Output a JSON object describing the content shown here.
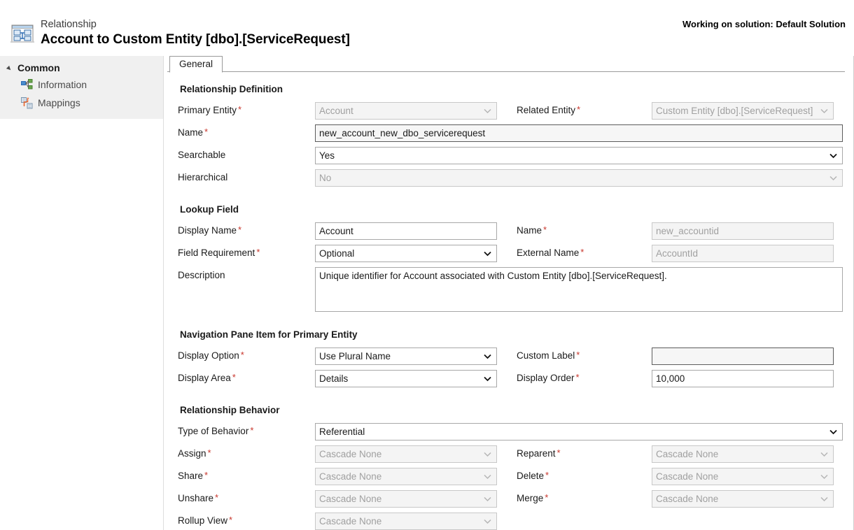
{
  "header": {
    "eyebrow": "Relationship",
    "title": "Account to Custom Entity [dbo].[ServiceRequest]",
    "solution_note": "Working on solution: Default Solution",
    "icon": "relationship-entity-icon"
  },
  "sidebar": {
    "group_label": "Common",
    "items": [
      {
        "label": "Information",
        "icon": "information-relationship-icon"
      },
      {
        "label": "Mappings",
        "icon": "mappings-icon"
      }
    ]
  },
  "tabs": [
    {
      "label": "General",
      "selected": true
    }
  ],
  "sections": {
    "relationship_definition": {
      "title": "Relationship Definition",
      "primary_entity": {
        "label": "Primary Entity",
        "required": true,
        "value": "Account",
        "disabled": true
      },
      "related_entity": {
        "label": "Related Entity",
        "required": true,
        "value": "Custom Entity [dbo].[ServiceRequest]",
        "disabled": true
      },
      "name": {
        "label": "Name",
        "required": true,
        "value": "new_account_new_dbo_servicerequest",
        "readonly": true
      },
      "searchable": {
        "label": "Searchable",
        "required": false,
        "value": "Yes",
        "disabled": false
      },
      "hierarchical": {
        "label": "Hierarchical",
        "required": false,
        "value": "No",
        "disabled": true
      }
    },
    "lookup_field": {
      "title": "Lookup Field",
      "display_name": {
        "label": "Display Name",
        "required": true,
        "value": "Account"
      },
      "name": {
        "label": "Name",
        "required": true,
        "value": "new_accountid",
        "disabled": true
      },
      "field_requirement": {
        "label": "Field Requirement",
        "required": true,
        "value": "Optional"
      },
      "external_name": {
        "label": "External Name",
        "required": true,
        "value": "AccountId",
        "disabled": true
      },
      "description": {
        "label": "Description",
        "required": false,
        "value": "Unique identifier for Account associated with Custom Entity [dbo].[ServiceRequest]."
      }
    },
    "navigation_pane": {
      "title": "Navigation Pane Item for Primary Entity",
      "display_option": {
        "label": "Display Option",
        "required": true,
        "value": "Use Plural Name"
      },
      "custom_label": {
        "label": "Custom Label",
        "required": true,
        "value": "",
        "readonly": true
      },
      "display_area": {
        "label": "Display Area",
        "required": true,
        "value": "Details"
      },
      "display_order": {
        "label": "Display Order",
        "required": true,
        "value": "10,000"
      }
    },
    "relationship_behavior": {
      "title": "Relationship Behavior",
      "type_of_behavior": {
        "label": "Type of Behavior",
        "required": true,
        "value": "Referential"
      },
      "assign": {
        "label": "Assign",
        "required": true,
        "value": "Cascade None",
        "disabled": true
      },
      "reparent": {
        "label": "Reparent",
        "required": true,
        "value": "Cascade None",
        "disabled": true
      },
      "share": {
        "label": "Share",
        "required": true,
        "value": "Cascade None",
        "disabled": true
      },
      "delete": {
        "label": "Delete",
        "required": true,
        "value": "Cascade None",
        "disabled": true
      },
      "unshare": {
        "label": "Unshare",
        "required": true,
        "value": "Cascade None",
        "disabled": true
      },
      "merge": {
        "label": "Merge",
        "required": true,
        "value": "Cascade None",
        "disabled": true
      },
      "rollup_view": {
        "label": "Rollup View",
        "required": true,
        "value": "Cascade None",
        "disabled": true
      }
    }
  },
  "colors": {
    "required_asterisk": "#c8352b",
    "sidebar_bg": "#f0f0f0",
    "disabled_text": "#a0a0a0",
    "accent_blue": "#2b6bb5"
  }
}
